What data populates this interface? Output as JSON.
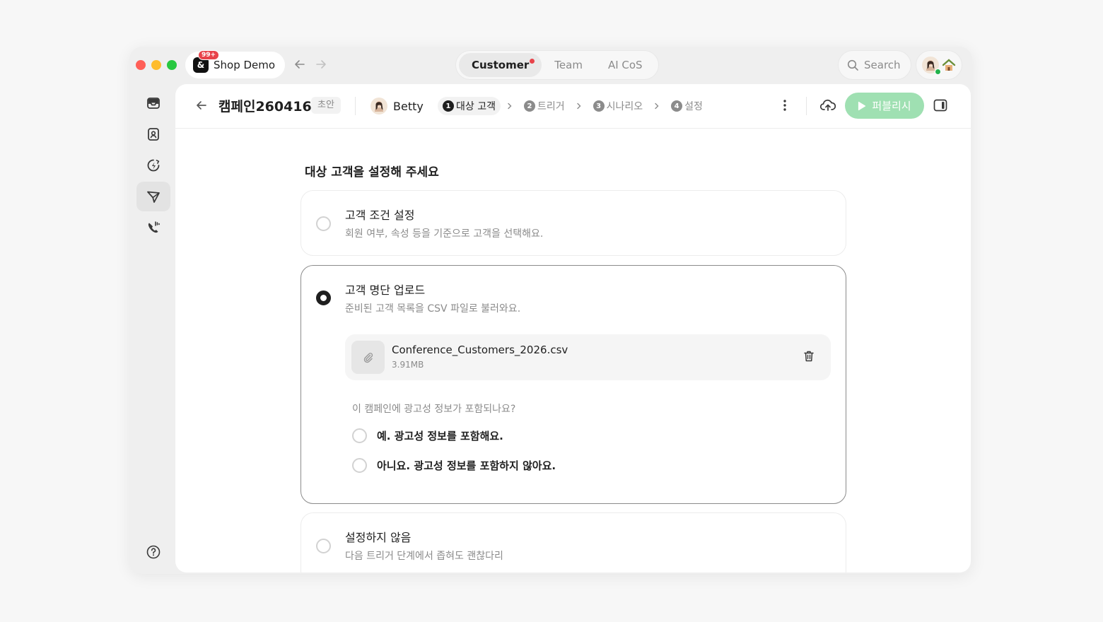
{
  "titlebar": {
    "workspace_name": "Shop Demo",
    "workspace_logo": "&",
    "notification_badge": "99+",
    "mode_tabs": [
      {
        "label": "Customer",
        "active": true
      },
      {
        "label": "Team",
        "active": false
      },
      {
        "label": "AI CoS",
        "active": false
      }
    ],
    "search_label": "Search"
  },
  "rail": {
    "items": [
      "inbox-icon",
      "contacts-icon",
      "workflow-icon",
      "campaign-icon",
      "call-icon"
    ],
    "active_item": "campaign-icon",
    "help_icon": "help-icon"
  },
  "toolbar": {
    "campaign_title": "캠페인260416",
    "status_badge": "초안",
    "owner_name": "Betty",
    "steps": [
      {
        "num": "1",
        "label": "대상 고객",
        "active": true
      },
      {
        "num": "2",
        "label": "트리거",
        "active": false
      },
      {
        "num": "3",
        "label": "시나리오",
        "active": false
      },
      {
        "num": "4",
        "label": "설정",
        "active": false
      }
    ],
    "publish_label": "퍼블리시"
  },
  "content": {
    "section_title": "대상 고객을 설정해 주세요",
    "options": [
      {
        "title": "고객 조건 설정",
        "desc": "회원 여부, 속성 등을 기준으로 고객을 선택해요.",
        "selected": false
      },
      {
        "title": "고객 명단 업로드",
        "desc": "준비된 고객 목록을 CSV 파일로 불러와요.",
        "selected": true
      },
      {
        "title": "설정하지 않음",
        "desc": "다음 트리거 단계에서 좁혀도 괜찮다리",
        "selected": false
      }
    ],
    "file": {
      "name": "Conference_Customers_2026.csv",
      "size": "3.91MB"
    },
    "ad_question": "이 캠페인에 광고성 정보가 포함되나요?",
    "ad_answers": [
      {
        "label": "예. 광고성 정보를 포함해요.",
        "selected": false
      },
      {
        "label": "아니요. 광고성 정보를 포함하지 않아요.",
        "selected": false
      }
    ]
  },
  "colors": {
    "accent_publish": "#9fe0b2",
    "badge_red": "#e8434a",
    "online_green": "#22b24c"
  }
}
